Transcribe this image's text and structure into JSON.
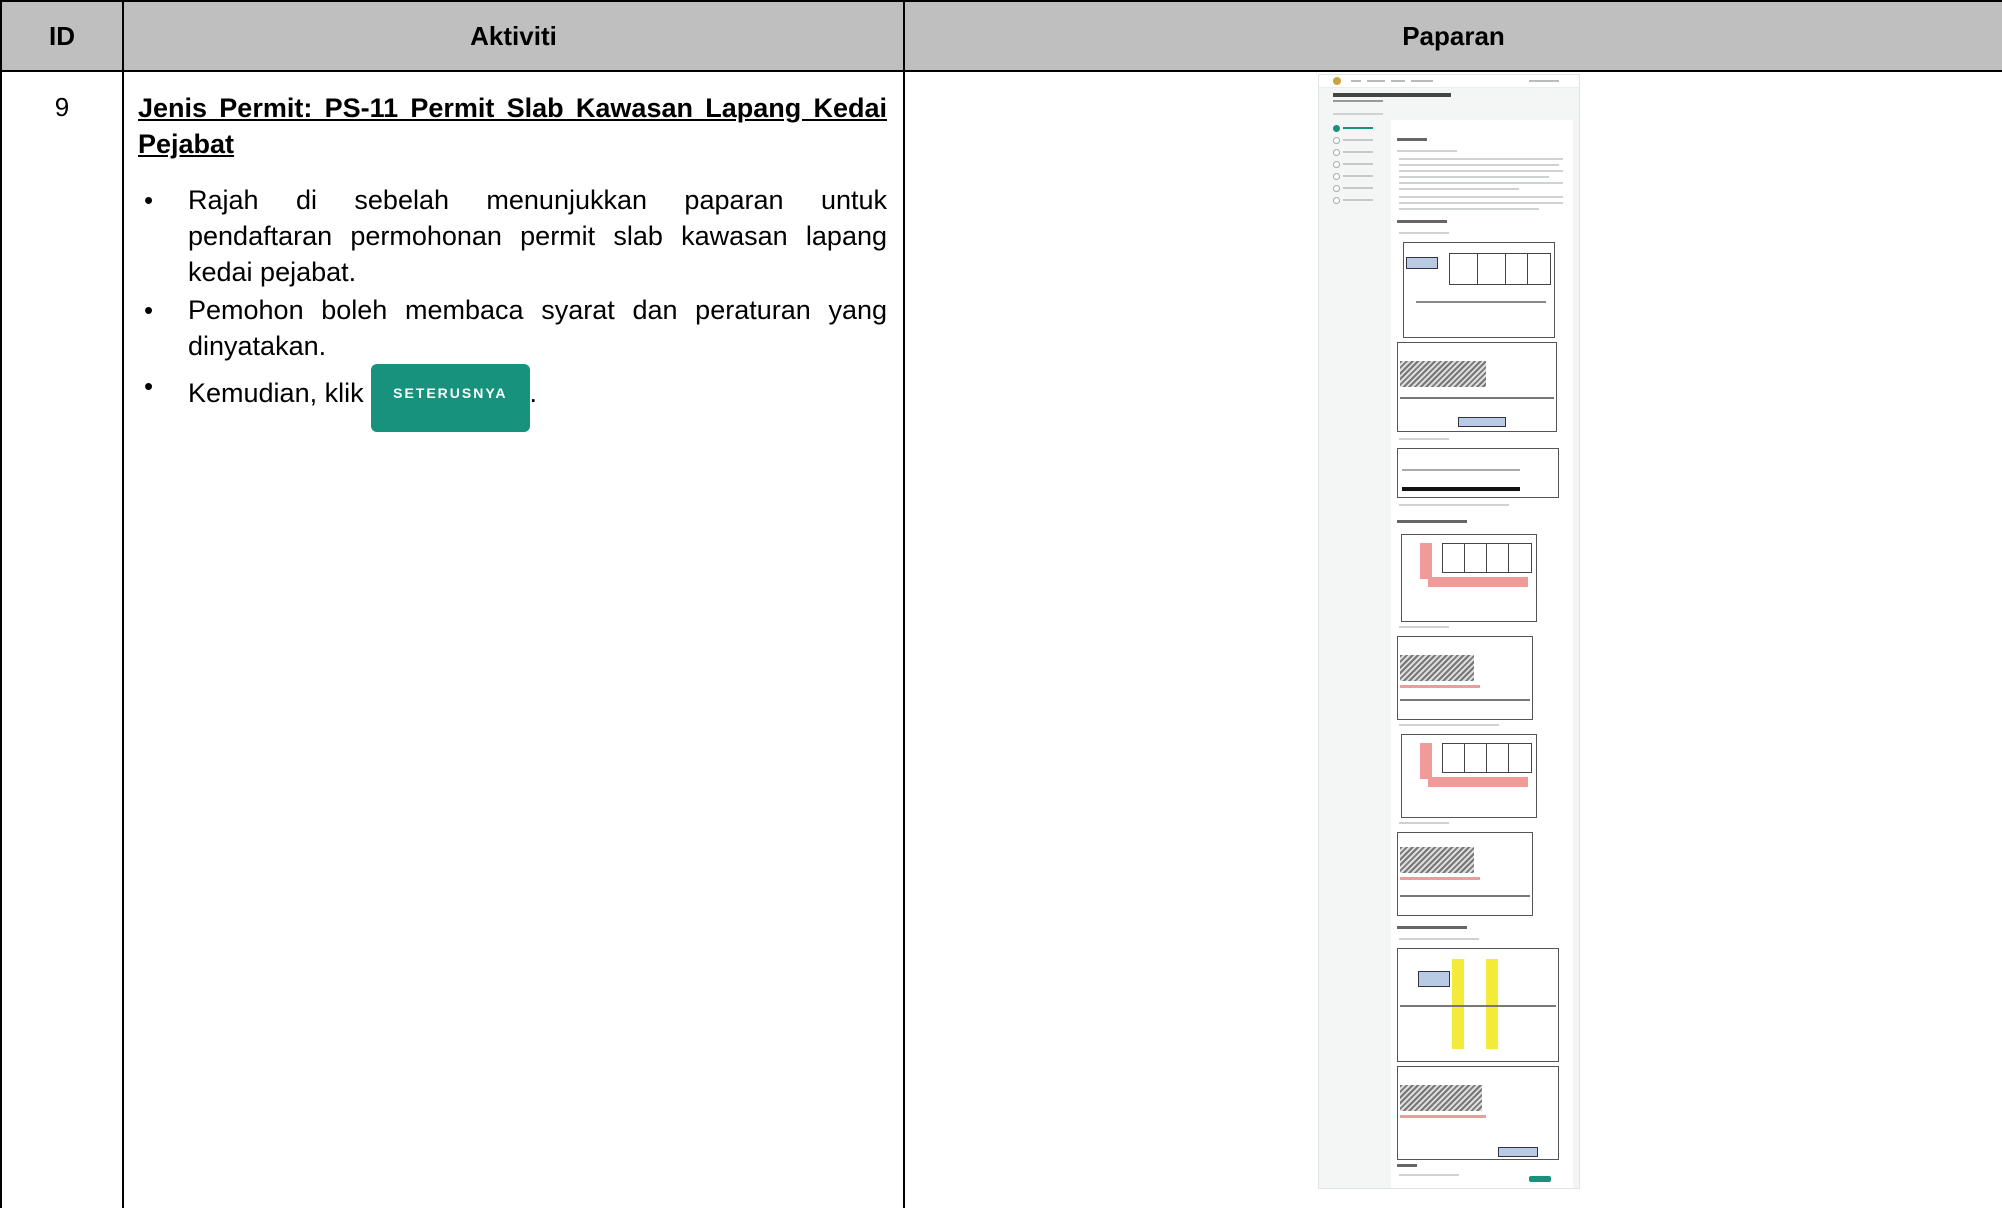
{
  "header": {
    "id": "ID",
    "activity": "Aktiviti",
    "display": "Paparan"
  },
  "row": {
    "id": "9",
    "title": "Jenis Permit: PS-11 Permit Slab Kawasan Lapang Kedai Pejabat",
    "bullets": [
      "Rajah di sebelah menunjukkan paparan untuk pendaftaran permohonan permit slab kawasan lapang kedai pejabat.",
      "Pemohon boleh membaca syarat dan peraturan yang dinyatakan."
    ],
    "click_prefix": "Kemudian, klik",
    "click_suffix": ".",
    "button_label": "SETERUSNYA"
  },
  "colors": {
    "header_bg": "#bfbfbf",
    "button": "#17927c"
  }
}
